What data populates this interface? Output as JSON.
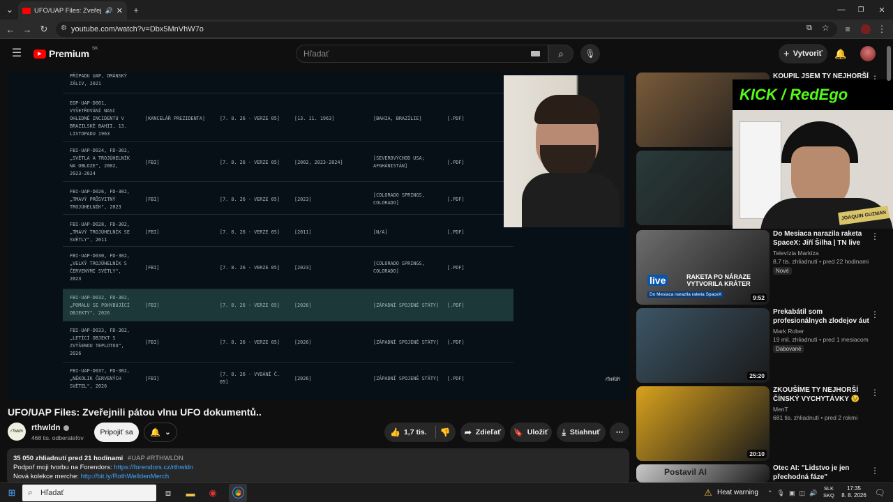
{
  "browser": {
    "tab_title": "UFO/UAP Files: Zveřejnili p",
    "url": "youtube.com/watch?v=Dbx5MnVhW7o"
  },
  "youtube": {
    "logo": "Premium",
    "region": "SK",
    "search_placeholder": "Hľadať",
    "create_label": "Vytvoriť"
  },
  "player": {
    "watermark": "rtwldn",
    "document_rows": [
      {
        "id": "PŘÍPADU UAP, OMÁNSKÝ\nZÁLIV, 2021",
        "agency": "",
        "date": "",
        "period": "",
        "place": "",
        "format": ""
      },
      {
        "id": "EOP-UAP-D001,\nVYŠETŘOVÁNÍ NASC\nOHLEDNĚ INCIDENTU V\nBRAZILSKÉ BAHII, 13.\nLISTOPADU 1963",
        "agency": "[KANCELÁŘ PREZIDENTA]",
        "date": "[7. 8. 26 - VERZE 05]",
        "period": "[13. 11. 1963]",
        "place": "[BAHIA, BRAZÍLIE]",
        "format": "[.PDF]"
      },
      {
        "id": "FBI-UAP-D024, FD-302,\n„SVĚTLA A TROJÚHELNÍK\nNA OBLOZE\", 2002,\n2023-2024",
        "agency": "[FBI]",
        "date": "[7. 8. 26 - VERZE 05]",
        "period": "[2002, 2023-2024]",
        "place": "[SEVEROVÝCHOD USA;\nAFGHÁNISTÁN]",
        "format": "[.PDF]"
      },
      {
        "id": "FBI-UAP-D026, FD-302,\n„TMAVÝ PRŮSVITNÝ\nTROJÚHELNÍK\", 2023",
        "agency": "[FBI]",
        "date": "[7. 8. 26 - VERZE 05]",
        "period": "[2023]",
        "place": "[COLORADO SPRINGS,\nCOLORADO]",
        "format": "[.PDF]"
      },
      {
        "id": "FBI-UAP-D028, FD-302,\n„TMAVÝ TROJÚHELNÍK SE\nSVĚTLY\", 2011",
        "agency": "[FBI]",
        "date": "[7. 8. 26 - VERZE 05]",
        "period": "[2011]",
        "place": "[N/A]",
        "format": "[.PDF]"
      },
      {
        "id": "FBI-UAP-D030, FD-302,\n„VELKÝ TROJÚHELNÍK S\nČERVENÝMI SVĚTLY\",\n2023",
        "agency": "[FBI]",
        "date": "[7. 8. 26 - VERZE 05]",
        "period": "[2023]",
        "place": "[COLORADO SPRINGS,\nCOLORADO]",
        "format": "[.PDF]"
      },
      {
        "id": "FBI-UAP-D032, FD-302,\n„POMALU SE POHYBUJÍCÍ\nOBJEKTY\", 2026",
        "agency": "[FBI]",
        "date": "[7. 8. 26 - VERZE 05]",
        "period": "[2026]",
        "place": "[ZÁPADNÍ SPOJENÉ STÁTY]",
        "format": "[.PDF]"
      },
      {
        "id": "FBI-UAP-D033, FD-302,\n„LETÍCÍ OBJEKT S\nZVÝŠENOU TEPLOTOU\",\n2026",
        "agency": "[FBI]",
        "date": "[7. 8. 26 - VERZE 05]",
        "period": "[2026]",
        "place": "[ZÁPADNÍ SPOJENÉ STÁTY]",
        "format": "[.PDF]"
      },
      {
        "id": "FBI-UAP-D037, FD-302,\n„NĚKOLIK ČERVENÝCH\nSVĚTEL\", 2026",
        "agency": "[FBI]",
        "date": "[7. 8. 26 - VYDÁNÍ Č.\n05]",
        "period": "[2026]",
        "place": "[ZÁPADNÍ SPOJENÉ STÁTY]",
        "format": "[.PDF]"
      }
    ]
  },
  "video": {
    "title": "UFO/UAP Files: Zveřejnili pátou vlnu UFO dokumentů..",
    "channel": "rthwldn",
    "channel_avatar_text": "rTwldn",
    "subscribers": "468 tis. odberateľov",
    "join_label": "Pripojiť sa",
    "likes": "1,7 tis.",
    "share_label": "Zdieľať",
    "save_label": "Uložiť",
    "download_label": "Stiahnuť",
    "views_line": "35 050 zhliadnutí  pred 21 hodinami",
    "hashtags": "#UAP #RTHWLDN",
    "desc_line1": "Podpoř moji tvorbu na Forendors: ",
    "desc_link1": "https://forendors.cz/rthwldn",
    "desc_line2": "Nová kolekce merche: ",
    "desc_link2": "http://bit.ly/RothWelldenMerch"
  },
  "sidebar": [
    {
      "title": "KOUPIL JSEM TY NEJHORŠÍ",
      "channel": "",
      "meta": "",
      "badge": "",
      "duration": "",
      "thumb_color": "#7a5b3a"
    },
    {
      "title": "",
      "channel": "",
      "meta": "",
      "badge": "",
      "duration": "",
      "thumb_color": "#2a3a3a"
    },
    {
      "title": "Do Mesiaca narazila raketa SpaceX: Jiří Šilha | TN live",
      "channel": "Televízia Markíza",
      "meta": "8,7 tis. zhliadnutí • pred 22 hodinami",
      "badge": "Nové",
      "duration": "9:52",
      "thumb_color": "#6d6d6d",
      "thumb_text": "RAKETA PO NÁRAZE\nVYTVORILA KRÁTER",
      "thumb_sub": "Do Mesiaca narazila raketa SpaceX",
      "thumb_logo": "live"
    },
    {
      "title": "Prekabátil som profesionálnych zlodejov áut",
      "channel": "Mark Rober",
      "meta": "19 mil. zhliadnutí • pred 1 mesiacom",
      "badge": "Dabované",
      "duration": "25:20",
      "thumb_color": "#3c5566"
    },
    {
      "title": "ZKOUŠÍME TY NEJHORŠÍ ČÍNSKÝ VYCHYTÁVKY 😉",
      "channel": "MenT",
      "meta": "681 tis. zhliadnutí • pred 2 rokmi",
      "badge": "",
      "duration": "20:10",
      "thumb_color": "#d9a21e"
    },
    {
      "title": "Otec AI: \"Lidstvo je jen přechodná fáze\"",
      "channel": "",
      "meta": "",
      "badge": "",
      "duration": "",
      "thumb_color": "#c9c9c9",
      "thumb_text": "Postavil AI"
    }
  ],
  "stream_overlay": {
    "brand": "KICK / RedEgo",
    "cap_text": "JOAQUIN GUZMAN"
  },
  "taskbar": {
    "search_placeholder": "Hľadať",
    "weather": "Heat warning",
    "lang_top": "SLK",
    "lang_bottom": "SKQ",
    "time": "17:35",
    "date": "8. 8. 2026"
  }
}
